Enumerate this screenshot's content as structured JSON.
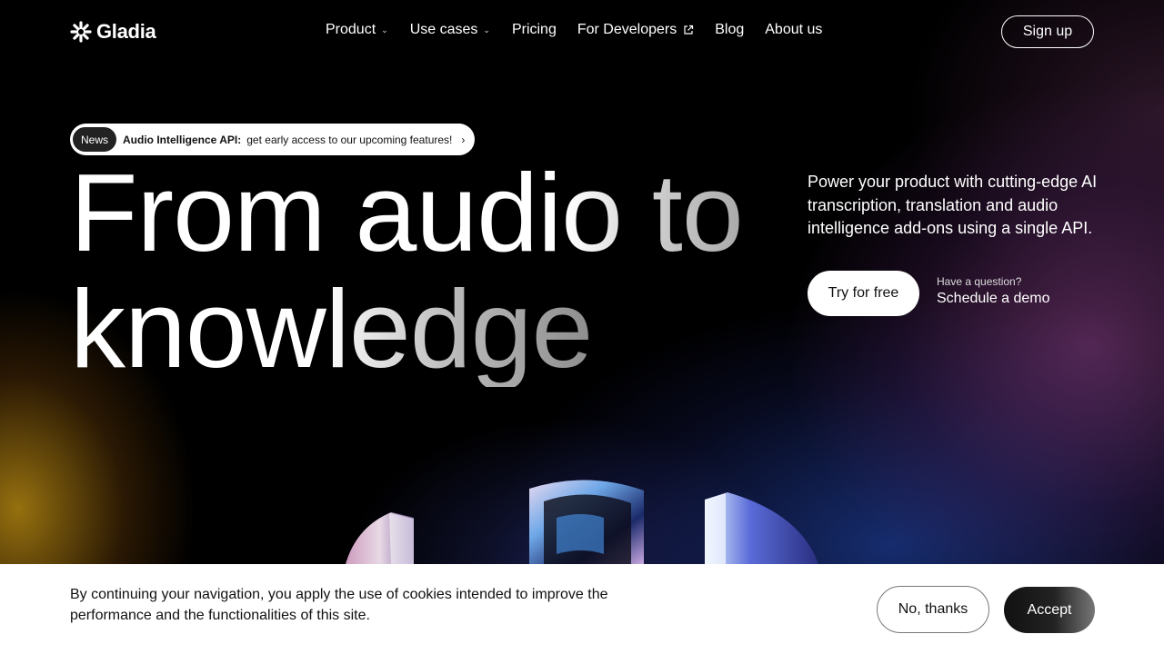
{
  "nav": {
    "logo_text": "Gladia",
    "items": [
      {
        "label": "Product",
        "dropdown": true
      },
      {
        "label": "Use cases",
        "dropdown": true
      },
      {
        "label": "Pricing"
      },
      {
        "label": "For Developers",
        "external": true
      },
      {
        "label": "Blog"
      },
      {
        "label": "About us"
      }
    ],
    "signup_label": "Sign up"
  },
  "news": {
    "tag": "News",
    "title": "Audio Intelligence API:",
    "text": "get early access to our upcoming features!"
  },
  "hero": {
    "line1": "From audio to",
    "line2": "knowledge",
    "tagline": "Power your product with cutting-edge AI transcription, translation and audio intelligence add-ons using a single API.",
    "cta_primary": "Try for free",
    "question": "Have a question?",
    "cta_secondary": "Schedule a demo"
  },
  "cookie": {
    "text": "By continuing your navigation, you apply the use of cookies intended to improve the performance and the functionalities of this site.",
    "decline_label": "No, thanks",
    "accept_label": "Accept"
  }
}
